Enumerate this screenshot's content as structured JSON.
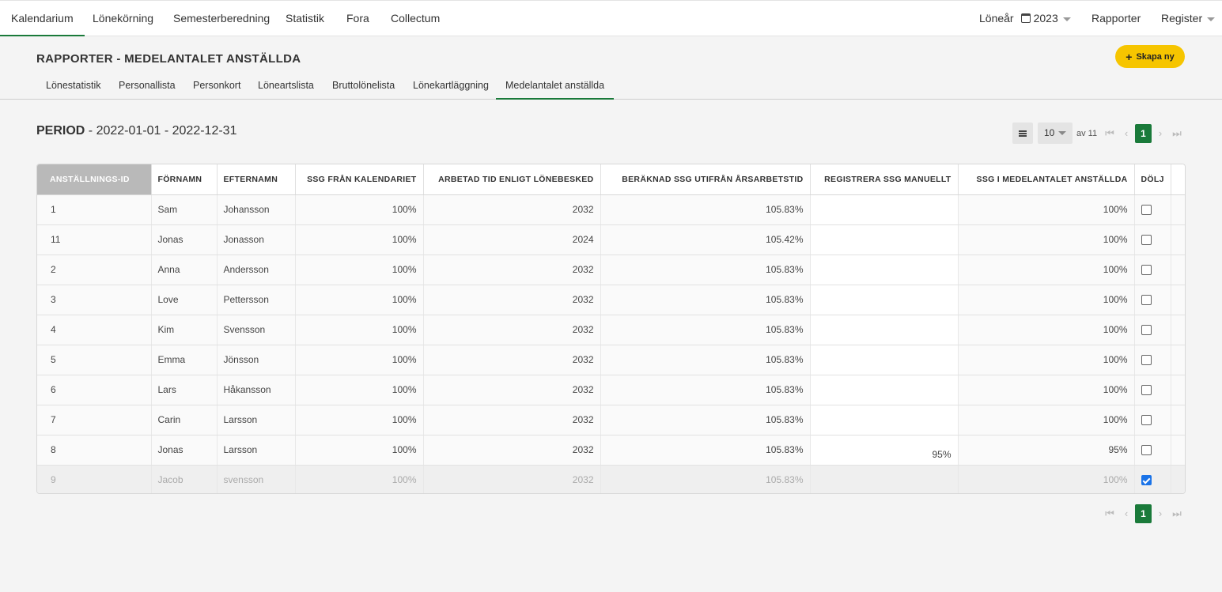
{
  "topnav": {
    "left": [
      {
        "label": "Kalendarium",
        "active": true
      },
      {
        "label": "Lönekörning"
      },
      {
        "label": "Semesterberedning"
      },
      {
        "label": "Statistik"
      },
      {
        "label": "Fora"
      },
      {
        "label": "Collectum"
      }
    ],
    "loneyear_label": "Löneår",
    "loneyear_value": "2023",
    "reports_label": "Rapporter",
    "register_label": "Register"
  },
  "page": {
    "title": "RAPPORTER - MEDELANTALET ANSTÄLLDA",
    "create_button": "Skapa ny",
    "subtabs": [
      "Lönestatistik",
      "Personallista",
      "Personkort",
      "Löneartslista",
      "Bruttolönelista",
      "Lönekartläggning",
      "Medelantalet anställda"
    ],
    "active_subtab": "Medelantalet anställda"
  },
  "period": {
    "label": "PERIOD",
    "range": "- 2022-01-01 - 2022-12-31"
  },
  "pager": {
    "page_size": "10",
    "of_label": "av 11",
    "current_page": "1",
    "first_icon": "first-page-icon",
    "prev_icon": "chevron-left-icon",
    "next_icon": "chevron-right-icon",
    "last_icon": "last-page-icon"
  },
  "table": {
    "columns": [
      "ANSTÄLLNINGS-ID",
      "FÖRNAMN",
      "EFTERNAMN",
      "SSG FRÅN KALENDARIET",
      "ARBETAD TID ENLIGT LÖNEBESKED",
      "BERÄKNAD SSG UTIFRÅN ÅRSARBETSTID",
      "REGISTRERA SSG MANUELLT",
      "SSG I MEDELANTALET ANSTÄLLDA",
      "DÖLJ"
    ],
    "rows": [
      {
        "id": "1",
        "first": "Sam",
        "last": "Johansson",
        "ssg_cal": "100%",
        "worked": "2032",
        "calc": "105.83%",
        "manual": "",
        "ssg_avg": "100%",
        "hide": false
      },
      {
        "id": "11",
        "first": "Jonas",
        "last": "Jonasson",
        "ssg_cal": "100%",
        "worked": "2024",
        "calc": "105.42%",
        "manual": "",
        "ssg_avg": "100%",
        "hide": false
      },
      {
        "id": "2",
        "first": "Anna",
        "last": "Andersson",
        "ssg_cal": "100%",
        "worked": "2032",
        "calc": "105.83%",
        "manual": "",
        "ssg_avg": "100%",
        "hide": false
      },
      {
        "id": "3",
        "first": "Love",
        "last": "Pettersson",
        "ssg_cal": "100%",
        "worked": "2032",
        "calc": "105.83%",
        "manual": "",
        "ssg_avg": "100%",
        "hide": false
      },
      {
        "id": "4",
        "first": "Kim",
        "last": "Svensson",
        "ssg_cal": "100%",
        "worked": "2032",
        "calc": "105.83%",
        "manual": "",
        "ssg_avg": "100%",
        "hide": false
      },
      {
        "id": "5",
        "first": "Emma",
        "last": "Jönsson",
        "ssg_cal": "100%",
        "worked": "2032",
        "calc": "105.83%",
        "manual": "",
        "ssg_avg": "100%",
        "hide": false
      },
      {
        "id": "6",
        "first": "Lars",
        "last": "Håkansson",
        "ssg_cal": "100%",
        "worked": "2032",
        "calc": "105.83%",
        "manual": "",
        "ssg_avg": "100%",
        "hide": false
      },
      {
        "id": "7",
        "first": "Carin",
        "last": "Larsson",
        "ssg_cal": "100%",
        "worked": "2032",
        "calc": "105.83%",
        "manual": "",
        "ssg_avg": "100%",
        "hide": false
      },
      {
        "id": "8",
        "first": "Jonas",
        "last": "Larsson",
        "ssg_cal": "100%",
        "worked": "2032",
        "calc": "105.83%",
        "manual": "95%",
        "ssg_avg": "95%",
        "hide": false
      },
      {
        "id": "9",
        "first": "Jacob",
        "last": "svensson",
        "ssg_cal": "100%",
        "worked": "2032",
        "calc": "105.83%",
        "manual": "",
        "ssg_avg": "100%",
        "hide": true
      }
    ]
  },
  "colors": {
    "accent_green": "#1a7a3a",
    "create_yellow": "#f6c500",
    "sorted_header": "#b9b9b9",
    "checkbox_blue": "#1a73e8"
  }
}
